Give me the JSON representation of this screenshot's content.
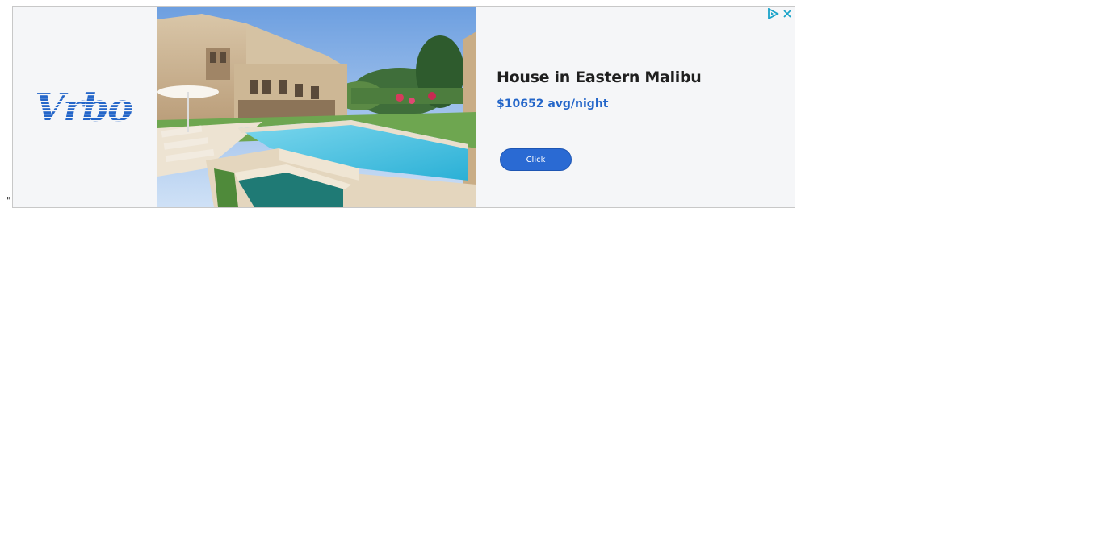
{
  "stray_text": "\"",
  "ad": {
    "brand_logo_text": "Vrbo",
    "listing_title": "House in Eastern Malibu",
    "price": "$10652 avg/night",
    "cta_label": "Click",
    "brand_color": "#2466c9",
    "icons": [
      "adchoices-icon",
      "close-icon"
    ]
  }
}
